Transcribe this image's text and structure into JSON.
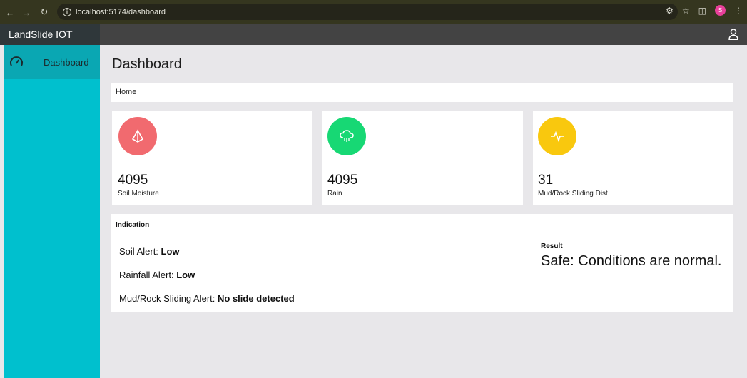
{
  "browser": {
    "url": "localhost:5174/dashboard",
    "profile_initial": "S"
  },
  "app": {
    "brand": "LandSlide IOT"
  },
  "sidebar": {
    "items": [
      {
        "label": "Dashboard",
        "icon": "speedometer-icon"
      }
    ]
  },
  "main": {
    "title": "Dashboard",
    "breadcrumb": "Home",
    "cards": [
      {
        "value": "4095",
        "label": "Soil Moisture",
        "icon": "drop-icon",
        "color": "#f16a6f"
      },
      {
        "value": "4095",
        "label": "Rain",
        "icon": "rain-cloud-icon",
        "color": "#17d874"
      },
      {
        "value": "31",
        "label": "Mud/Rock Sliding Dist",
        "icon": "pulse-icon",
        "color": "#f9c80e"
      }
    ],
    "indication": {
      "title": "Indication",
      "alerts": [
        {
          "label": "Soil Alert: ",
          "value": "Low"
        },
        {
          "label": "Rainfall Alert: ",
          "value": "Low"
        },
        {
          "label": "Mud/Rock Sliding Alert: ",
          "value": "No slide detected"
        }
      ],
      "result_label": "Result",
      "result_text": "Safe: Conditions are normal."
    }
  }
}
